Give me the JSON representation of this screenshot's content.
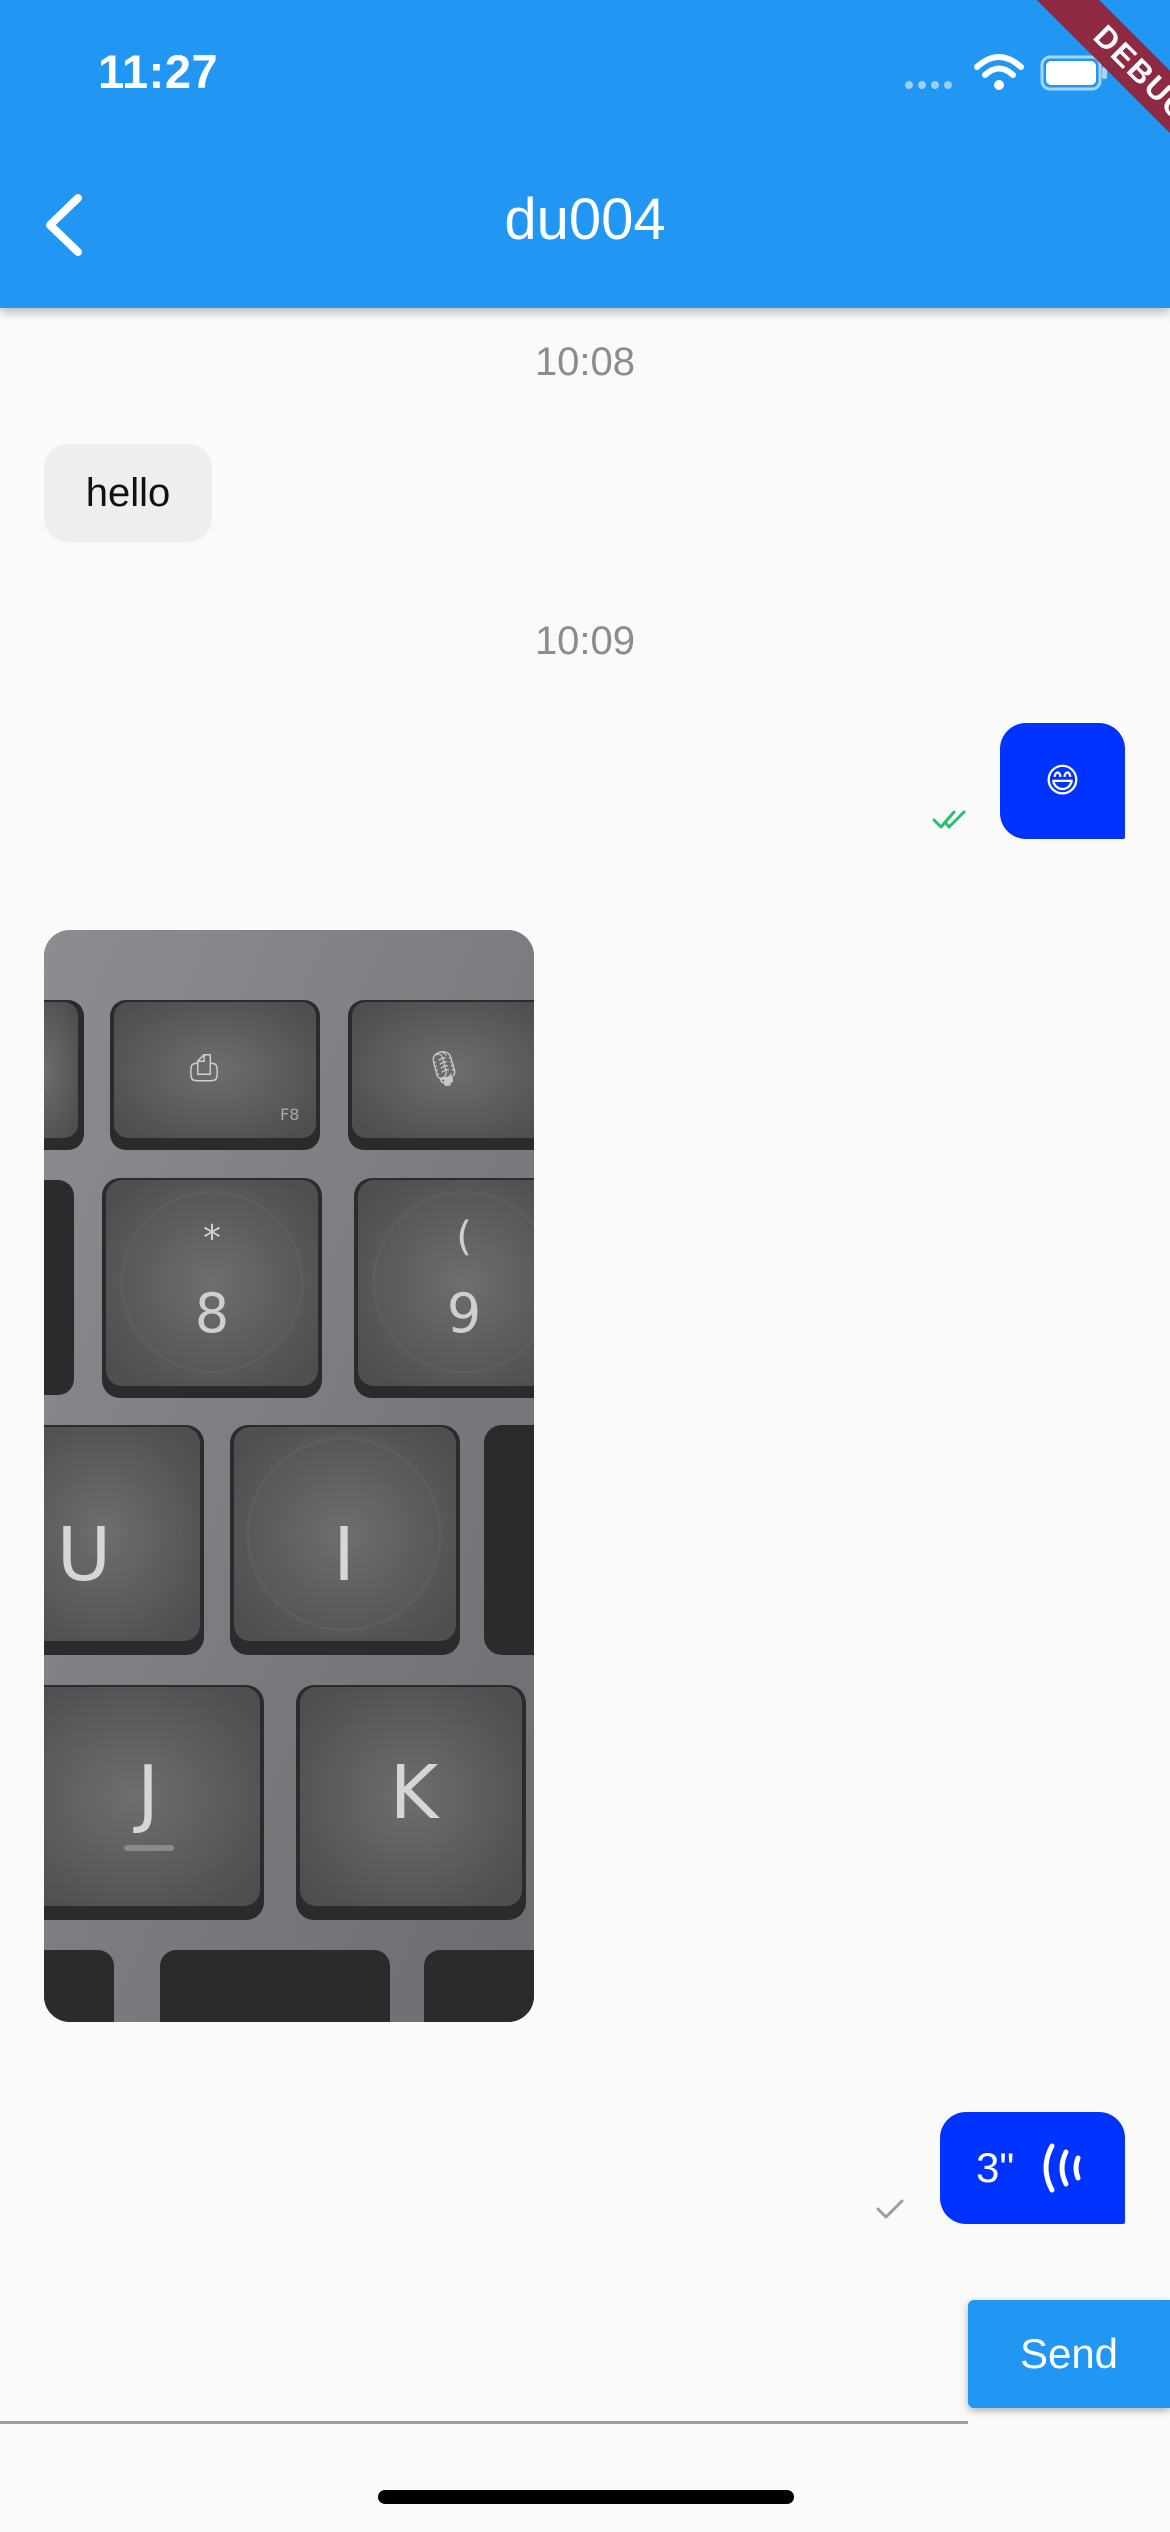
{
  "status_bar": {
    "time": "11:27",
    "wifi_icon": "wifi-icon",
    "battery_icon": "battery-icon"
  },
  "debug_banner": "DEBUG",
  "app_bar": {
    "title": "du004",
    "back_icon": "chevron-left-icon",
    "background": "#2196F3"
  },
  "messages": [
    {
      "type": "timestamp",
      "text": "10:08"
    },
    {
      "type": "text",
      "direction": "incoming",
      "text": "hello"
    },
    {
      "type": "timestamp",
      "text": "10:09"
    },
    {
      "type": "emoji",
      "direction": "outgoing",
      "text": "😄",
      "status": "read",
      "status_icon": "double-check-icon",
      "status_color": "#25C16F"
    },
    {
      "type": "image",
      "direction": "incoming",
      "description_icon": "photo-keyboard-keys"
    },
    {
      "type": "voice",
      "direction": "outgoing",
      "duration_text": "3\"",
      "voice_icon": "voice-wave-icon",
      "status": "sent",
      "status_icon": "check-icon",
      "status_color": "#9E9E9E"
    }
  ],
  "composer": {
    "input_value": "",
    "send_label": "Send"
  },
  "colors": {
    "outgoing_bubble": "#0033FF",
    "incoming_bubble": "#EEEEEE",
    "background": "#FAFAFA"
  }
}
